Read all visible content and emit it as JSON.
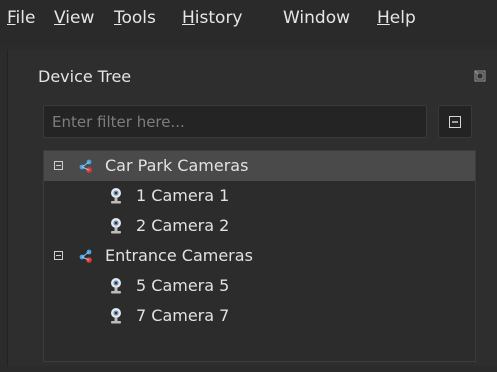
{
  "menubar": {
    "file": {
      "mnemonic": "F",
      "rest": "ile"
    },
    "view": {
      "mnemonic": "V",
      "rest": "iew"
    },
    "tools": {
      "mnemonic": "T",
      "rest": "ools"
    },
    "history": {
      "mnemonic": "H",
      "rest": "istory"
    },
    "window": {
      "label": "Window"
    },
    "help": {
      "mnemonic": "H",
      "rest": "elp"
    }
  },
  "panel": {
    "title": "Device Tree",
    "float_icon": "float-panel-icon"
  },
  "filter": {
    "placeholder": "Enter filter here...",
    "value": "",
    "collapse_icon": "collapse-all-icon"
  },
  "tree": {
    "groups": [
      {
        "label": "Car Park Cameras",
        "icon": "camera-group-icon",
        "expanded": true,
        "selected": true,
        "children": [
          {
            "label": "1 Camera 1",
            "icon": "webcam-icon"
          },
          {
            "label": "2 Camera 2",
            "icon": "webcam-icon"
          }
        ]
      },
      {
        "label": "Entrance Cameras",
        "icon": "camera-group-icon",
        "expanded": true,
        "selected": false,
        "children": [
          {
            "label": "5 Camera 5",
            "icon": "webcam-icon"
          },
          {
            "label": "7 Camera 7",
            "icon": "webcam-icon"
          }
        ]
      }
    ]
  },
  "colors": {
    "background": "#2b2b2b",
    "selected_row": "#4a4a4a",
    "text": "#e2e2e2",
    "placeholder": "#7d7d7d"
  }
}
